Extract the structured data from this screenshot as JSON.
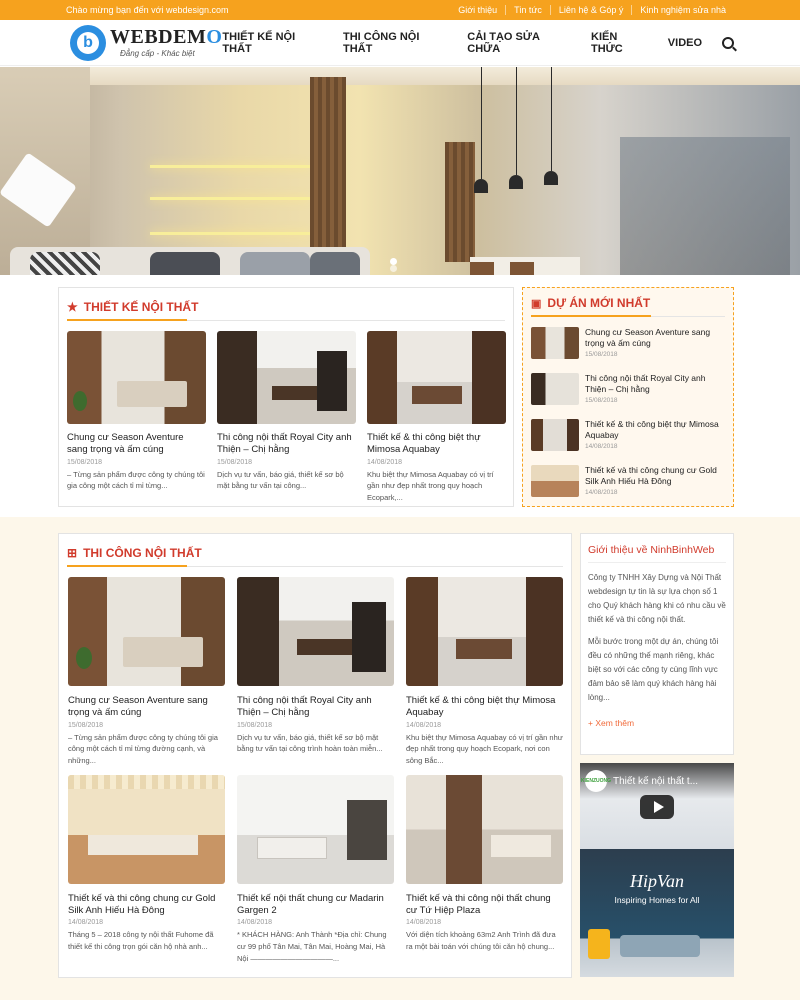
{
  "topbar": {
    "welcome": "Chào mừng bạn đến với webdesign.com",
    "links": [
      "Giới thiệu",
      "Tin tức",
      "Liên hệ & Góp ý",
      "Kinh nghiệm sửa nhà"
    ]
  },
  "header": {
    "logo_title_prefix": "WEBDEM",
    "logo_title_suffix": "O",
    "logo_slogan": "Đẳng cấp - Khác biệt",
    "logo_letter": "b",
    "nav": [
      "THIẾT KẾ NỘI THẤT",
      "THI CÔNG NỘI THẤT",
      "CẢI TẠO SỬA CHỮA",
      "KIẾN THỨC",
      "VIDEO"
    ]
  },
  "colors": {
    "accent": "#f6a21e",
    "title_red": "#d13b2c",
    "link_blue": "#2b8ee0",
    "band_bg": "#fdf7ea"
  },
  "section_design": {
    "title": "THIẾT KẾ NỘI THẤT",
    "icon": "star-icon",
    "items": [
      {
        "title": "Chung cư Season Aventure sang trọng và ấm cúng",
        "date": "15/08/2018",
        "desc": "– Từng sản phẩm được công ty chúng tôi gia công một cách tỉ mỉ từng..."
      },
      {
        "title": "Thi công nội thất Royal City anh Thiện – Chị hằng",
        "date": "15/08/2018",
        "desc": "Dịch vụ tư vấn, báo giá, thiết kế sơ bộ mặt bằng tư vấn tại công..."
      },
      {
        "title": "Thiết kế & thi công biệt thự Mimosa Aquabay",
        "date": "14/08/2018",
        "desc": "Khu biệt thự Mimosa Aquabay có vị trí gần như đẹp nhất trong quy hoạch Ecopark,..."
      }
    ]
  },
  "latest_projects": {
    "title": "DỰ ÁN MỚI NHẤT",
    "icon": "briefcase-icon",
    "items": [
      {
        "title": "Chung cư Season Aventure sang trọng và ấm cúng",
        "date": "15/08/2018"
      },
      {
        "title": "Thi công nội thất Royal City anh Thiện – Chị hằng",
        "date": "15/08/2018"
      },
      {
        "title": "Thiết kế & thi công biệt thự Mimosa Aquabay",
        "date": "14/08/2018"
      },
      {
        "title": "Thiết kế và thi công chung cư Gold Silk Anh Hiếu Hà Đông",
        "date": "14/08/2018"
      }
    ]
  },
  "section_build": {
    "title": "THI CÔNG NỘI THẤT",
    "icon": "gift-icon",
    "items": [
      {
        "title": "Chung cư Season Aventure sang trọng và ấm cúng",
        "date": "15/08/2018",
        "desc": "– Từng sản phẩm được công ty chúng tôi gia công một cách tỉ mỉ từng đường cạnh, và những..."
      },
      {
        "title": "Thi công nội thất Royal City anh Thiện – Chị hằng",
        "date": "15/08/2018",
        "desc": "Dịch vụ tư vấn, báo giá, thiết kế sơ bộ mặt bằng tư vấn tại công trình hoàn toàn miễn..."
      },
      {
        "title": "Thiết kế & thi công biệt thự Mimosa Aquabay",
        "date": "14/08/2018",
        "desc": "Khu biệt thự Mimosa Aquabay có vị trí gần như đẹp nhất trong quy hoạch Ecopark, nơi con sông Bắc..."
      },
      {
        "title": "Thiết kế và thi công chung cư Gold Silk Anh Hiếu Hà Đông",
        "date": "14/08/2018",
        "desc": "Tháng 5 – 2018 công ty nội thất Fuhome đã thiết kế thi công trọn gói căn hộ nhà anh..."
      },
      {
        "title": "Thiết kế nội thất chung cư Madarin Gargen 2",
        "date": "14/08/2018",
        "desc": "* KHÁCH HÀNG: Anh Thành *Địa chỉ: Chung cư 99 phố Tân Mai, Tân Mai, Hoàng Mai, Hà Nội ———————————..."
      },
      {
        "title": "Thiết kế và thi công nội thất chung cư Tứ Hiệp Plaza",
        "date": "14/08/2018",
        "desc": "Với diện tích khoảng 63m2 Anh Trình đã đưa ra một bài toán với chúng tôi căn hộ chung..."
      }
    ]
  },
  "about": {
    "title": "Giới thiệu về NinhBinhWeb",
    "para1": "Công ty TNHH Xây Dựng và Nội Thất webdesign tự tin là sự lựa chọn số 1 cho Quý khách hàng khi có nhu cầu về thiết kế và thi công nội thất.",
    "para2": "Mỗi bước trong một dự án, chúng tôi đều có những thế mạnh riêng, khác biệt so với các công ty cùng lĩnh vực đảm bảo sẽ làm quý khách hàng hài lòng...",
    "more": "+ Xem thêm"
  },
  "video": {
    "channel": "KIENZUONG",
    "title": "Thiết kế nội thất t...",
    "brand": "HipVan",
    "tagline": "Inspiring Homes for All"
  }
}
